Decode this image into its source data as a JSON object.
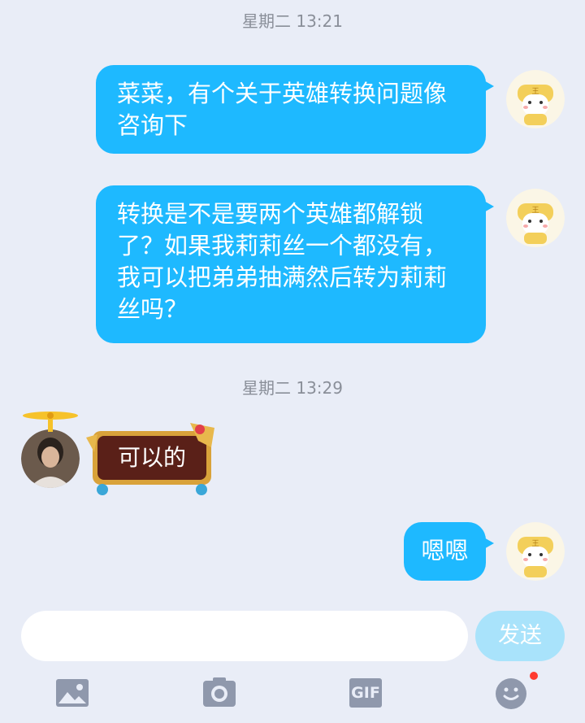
{
  "timestamps": [
    "星期二 13:21",
    "星期二 13:29"
  ],
  "messages": [
    {
      "sender": "self",
      "text": "菜菜，有个关于英雄转换问题像咨询下"
    },
    {
      "sender": "self",
      "text": "转换是不是要两个英雄都解锁了？如果我莉莉丝一个都没有，我可以把弟弟抽满然后转为莉莉丝吗？"
    },
    {
      "sender": "other",
      "text": "可以的"
    },
    {
      "sender": "self",
      "text": "嗯嗯"
    }
  ],
  "composer": {
    "input_value": "",
    "send_label": "发送"
  },
  "toolbar": {
    "icons": [
      "image-icon",
      "camera-icon",
      "gif-icon",
      "emoji-icon"
    ],
    "gif_label": "GIF",
    "emoji_has_notification": true
  },
  "colors": {
    "background": "#e9edf7",
    "bubble": "#1eb9ff",
    "send_button": "#a9e3fb",
    "toolbar_icon": "#8f98ac",
    "badge": "#ff3b30"
  }
}
